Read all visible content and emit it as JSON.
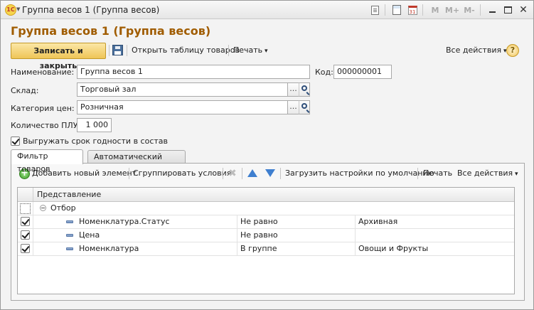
{
  "window": {
    "title": "Группа весов 1 (Группа весов)",
    "logo_text": "1С",
    "toolbar_icons": [
      "doc-icon",
      "calculator-icon",
      "calendar-icon",
      "m-icon",
      "m-plus-icon",
      "m-minus-icon",
      "maximize-icon",
      "close-icon"
    ],
    "m_label": "M",
    "m_plus_label": "M+",
    "m_minus_label": "M-",
    "calendar_day": "31"
  },
  "form": {
    "title": "Группа весов 1 (Группа весов)"
  },
  "command_bar": {
    "save_close_label": "Записать и закрыть",
    "open_table_label": "Открыть таблицу товаров",
    "print_label": "Печать",
    "all_actions_label": "Все действия",
    "help_label": "?"
  },
  "fields": {
    "name_label": "Наименование:",
    "name_value": "Группа весов 1",
    "code_label": "Код:",
    "code_value": "000000001",
    "warehouse_label": "Склад:",
    "warehouse_value": "Торговый зал",
    "price_category_label": "Категория цен:",
    "price_category_value": "Розничная",
    "plu_count_label": "Количество ПЛУ:",
    "plu_count_value": "1 000",
    "export_expiry_label": "Выгружать срок годности в состав",
    "export_expiry_checked": true,
    "pick_label": "..."
  },
  "tabs": [
    {
      "label": "Фильтр товаров",
      "active": true
    },
    {
      "label": "Автоматический обмен",
      "active": false
    }
  ],
  "filter_toolbar": {
    "add_label": "Добавить новый элемент",
    "group_label": "Сгруппировать условия",
    "load_defaults_label": "Загрузить настройки по умолчанию",
    "print_label": "Печать",
    "all_actions_label": "Все действия"
  },
  "grid": {
    "header": "Представление",
    "group_row": "Отбор",
    "rows": [
      {
        "field": "Номенклатура.Статус",
        "condition": "Не равно",
        "value": "Архивная",
        "checked": true
      },
      {
        "field": "Цена",
        "condition": "Не равно",
        "value": "",
        "checked": true
      },
      {
        "field": "Номенклатура",
        "condition": "В группе",
        "value": "Овощи и Фрукты",
        "checked": true
      }
    ]
  }
}
